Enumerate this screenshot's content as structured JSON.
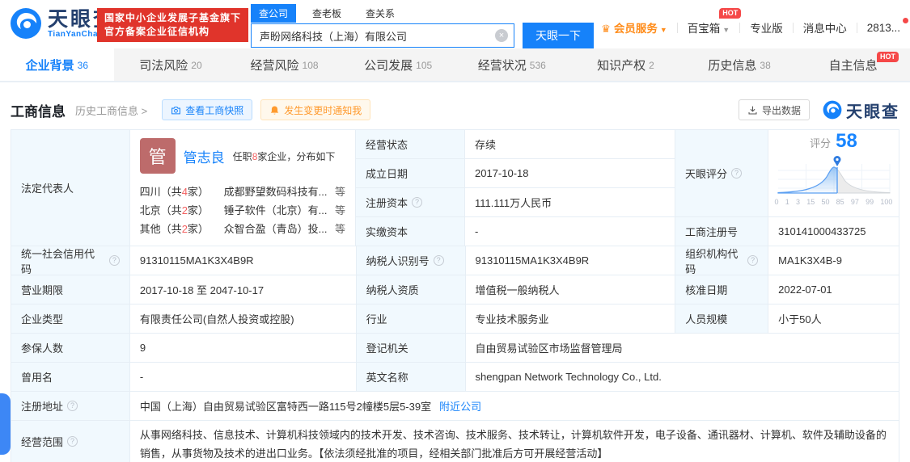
{
  "header": {
    "logo_title": "天眼查",
    "logo_subtitle": "TianYanCha.com",
    "badge_line1": "国家中小企业发展子基金旗下",
    "badge_line2": "官方备案企业征信机构",
    "search_tabs": [
      "查公司",
      "查老板",
      "查关系"
    ],
    "search_value": "声盼网络科技（上海）有限公司",
    "search_button": "天眼一下",
    "menu": {
      "vip": "会员服务",
      "toolbox": "百宝箱",
      "hot_badge": "HOT",
      "pro": "专业版",
      "messages": "消息中心",
      "phone": "2813..."
    }
  },
  "nav": {
    "tabs": [
      {
        "label": "企业背景",
        "count": "36"
      },
      {
        "label": "司法风险",
        "count": "20"
      },
      {
        "label": "经营风险",
        "count": "108"
      },
      {
        "label": "公司发展",
        "count": "105"
      },
      {
        "label": "经营状况",
        "count": "536"
      },
      {
        "label": "知识产权",
        "count": "2"
      },
      {
        "label": "历史信息",
        "count": "38"
      },
      {
        "label": "自主信息",
        "count": "",
        "hot": "HOT"
      }
    ]
  },
  "section": {
    "title": "工商信息",
    "history_link": "历史工商信息 >",
    "snapshot_button": "查看工商快照",
    "notify_button": "发生变更时通知我",
    "export_button": "导出数据",
    "brand": "天眼查"
  },
  "legal_rep": {
    "label": "法定代表人",
    "avatar_char": "管",
    "name": "管志良",
    "note_prefix": "任职",
    "note_count": "8",
    "note_suffix": "家企业，分布如下",
    "companies": [
      {
        "region_prefix": "四川（共",
        "num": "4",
        "region_suffix": "家）",
        "company": "成都野望数码科技有...",
        "etc": "等"
      },
      {
        "region_prefix": "北京（共",
        "num": "2",
        "region_suffix": "家）",
        "company": "锤子软件（北京）有...",
        "etc": "等"
      },
      {
        "region_prefix": "其他（共",
        "num": "2",
        "region_suffix": "家）",
        "company": "众智合盈（青岛）投...",
        "etc": "等"
      }
    ]
  },
  "score": {
    "label": "天眼评分",
    "prefix": "评分",
    "value": "58",
    "axis": [
      "0",
      "1",
      "3",
      "15",
      "50",
      "85",
      "97",
      "99",
      "100"
    ]
  },
  "fields": {
    "status": {
      "label": "经营状态",
      "value": "存续"
    },
    "established": {
      "label": "成立日期",
      "value": "2017-10-18"
    },
    "reg_capital": {
      "label": "注册资本",
      "value": "111.111万人民币"
    },
    "paid_capital": {
      "label": "实缴资本",
      "value": "-"
    },
    "reg_number": {
      "label": "工商注册号",
      "value": "310141000433725"
    },
    "credit_code": {
      "label": "统一社会信用代码",
      "value": "91310115MA1K3X4B9R"
    },
    "taxpayer_id": {
      "label": "纳税人识别号",
      "value": "91310115MA1K3X4B9R"
    },
    "org_code": {
      "label": "组织机构代码",
      "value": "MA1K3X4B-9"
    },
    "business_term": {
      "label": "营业期限",
      "value": "2017-10-18 至 2047-10-17"
    },
    "taxpayer_quality": {
      "label": "纳税人资质",
      "value": "增值税一般纳税人"
    },
    "approval_date": {
      "label": "核准日期",
      "value": "2022-07-01"
    },
    "company_type": {
      "label": "企业类型",
      "value": "有限责任公司(自然人投资或控股)"
    },
    "industry": {
      "label": "行业",
      "value": "专业技术服务业"
    },
    "staff_size": {
      "label": "人员规模",
      "value": "小于50人"
    },
    "insured_count": {
      "label": "参保人数",
      "value": "9"
    },
    "registry": {
      "label": "登记机关",
      "value": "自由贸易试验区市场监督管理局"
    },
    "former_name": {
      "label": "曾用名",
      "value": "-"
    },
    "english_name": {
      "label": "英文名称",
      "value": "shengpan Network Technology Co., Ltd."
    },
    "address": {
      "label": "注册地址",
      "value": "中国（上海）自由贸易试验区富特西一路115号2幢楼5层5-39室",
      "link": "附近公司"
    },
    "business_scope": {
      "label": "经营范围",
      "value": "从事网络科技、信息技术、计算机科技领域内的技术开发、技术咨询、技术服务、技术转让，计算机软件开发，电子设备、通讯器材、计算机、软件及辅助设备的销售，从事货物及技术的进出口业务。【依法须经批准的项目，经相关部门批准后方可开展经营活动】"
    }
  },
  "colors": {
    "accent_blue": "#1682fa",
    "badge_red": "#e0342b",
    "hot_red": "#f54848",
    "orange": "#ff8c1a",
    "label_bg": "#f1f9fe"
  }
}
